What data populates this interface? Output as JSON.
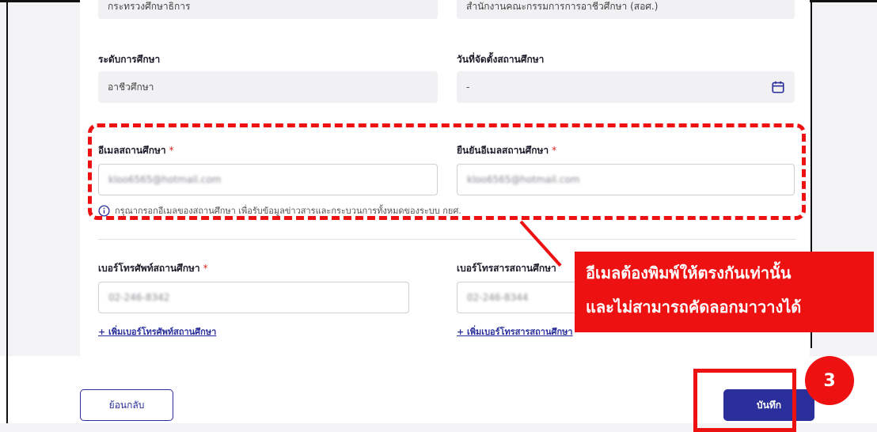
{
  "form": {
    "row0": {
      "left_value": "กระทรวงศึกษาธิการ",
      "right_value": "สำนักงานคณะกรรมการการอาชีวศึกษา (สอศ.)"
    },
    "education_level": {
      "label": "ระดับการศึกษา",
      "value": "อาชีวศึกษา"
    },
    "established_date": {
      "label": "วันที่จัดตั้งสถานศึกษา",
      "value": "-"
    },
    "email": {
      "label": "อีเมลสถานศึกษา",
      "required_mark": "*",
      "value": "kloo6565@hotmail.com"
    },
    "confirm_email": {
      "label": "ยืนยันอีเมลสถานศึกษา",
      "required_mark": "*",
      "value": "kloo6565@hotmail.com"
    },
    "email_hint": "กรุณากรอกอีเมลของสถานศึกษา เพื่อรับข้อมูลข่าวสารและกระบวนการทั้งหมดของระบบ กยศ.",
    "phone": {
      "label": "เบอร์โทรศัพท์สถานศึกษา",
      "required_mark": "*",
      "value": "02-246-8342",
      "add_link": "+ เพิ่มเบอร์โทรศัพท์สถานศึกษา"
    },
    "fax": {
      "label": "เบอร์โทรสารสถานศึกษา",
      "value": "02-246-8344",
      "add_link": "+ เพิ่มเบอร์โทรสารสถานศึกษา"
    }
  },
  "annotation": {
    "callout_line1": "อีเมลต้องพิมพ์ให้ตรงกันเท่านั้น",
    "callout_line2": "และไม่สามารถคัดลอกมาวางได้",
    "step_number": "3"
  },
  "footer": {
    "back_label": "ย้อนกลับ",
    "save_label": "บันทึก"
  },
  "colors": {
    "primary": "#2a2f9b",
    "annotation_red": "#ee1111",
    "required": "#d9231f"
  },
  "icons": [
    "calendar-icon",
    "info-icon"
  ]
}
